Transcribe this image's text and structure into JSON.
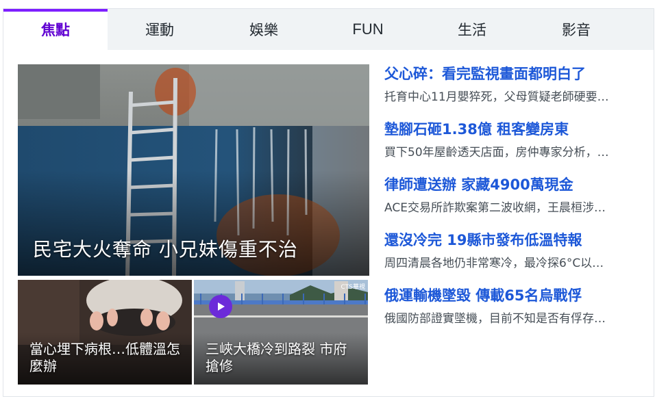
{
  "tabs": [
    "焦點",
    "運動",
    "娛樂",
    "FUN",
    "生活",
    "影音"
  ],
  "active_tab": "焦點",
  "colors": {
    "accent": "#6001d2",
    "link": "#1d58d8",
    "play": "#6c2bd9"
  },
  "hero": {
    "caption": "民宅大火奪命 小兄妹傷重不治"
  },
  "cards": [
    {
      "caption": "當心埋下病根…低體溫怎麼辦"
    },
    {
      "caption": "三峽大橋冷到路裂 市府搶修",
      "icon": "play-icon",
      "logo": "CTS華視"
    }
  ],
  "stories": [
    {
      "title": "父心碎：看完監視畫面都明白了",
      "summary": "托育中心11月嬰猝死，父母質疑老師硬要…"
    },
    {
      "title": "墊腳石砸1.38億 租客變房東",
      "summary": "買下50年屋齡透天店面，房仲專家分析，…"
    },
    {
      "title": "律師遭送辦 家藏4900萬現金",
      "summary": "ACE交易所詐欺案第二波收網，王晨桓涉…"
    },
    {
      "title": "還沒冷完 19縣市發布低溫特報",
      "summary": "周四清晨各地仍非常寒冷，最冷探6°C以…"
    },
    {
      "title": "俄運輸機墜毀 傳載65名烏戰俘",
      "summary": "俄國防部證實墜機，目前不知是否有俘存…"
    }
  ]
}
